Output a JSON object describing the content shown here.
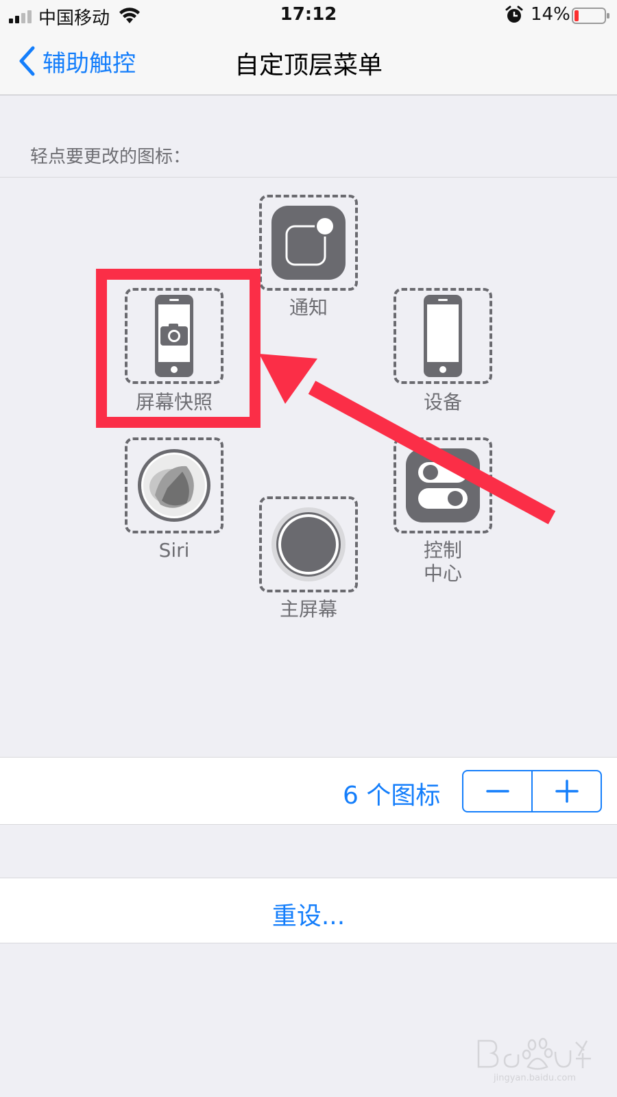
{
  "status_bar": {
    "carrier": "中国移动",
    "time": "17:12",
    "battery_percent": "14%",
    "icons": [
      "signal-icon",
      "wifi-icon",
      "alarm-icon",
      "battery-icon"
    ]
  },
  "nav": {
    "back_label": "辅助触控",
    "title": "自定顶层菜单"
  },
  "section_hint": "轻点要更改的图标：",
  "menu_icons": [
    {
      "label": "通知",
      "icon": "notification-icon"
    },
    {
      "label": "屏幕快照",
      "icon": "screenshot-icon"
    },
    {
      "label": "设备",
      "icon": "device-icon"
    },
    {
      "label": "Siri",
      "icon": "siri-icon"
    },
    {
      "label": "主屏幕",
      "icon": "home-icon"
    },
    {
      "label_line1": "控制",
      "label_line2": "中心",
      "icon": "control-center-icon"
    }
  ],
  "icon_count": {
    "label": "6 个图标",
    "decrement": "−",
    "increment": "+"
  },
  "reset_label": "重设...",
  "watermark_text": "Baidu经验 jingyan.baidu.com",
  "colors": {
    "accent": "#147efb",
    "highlight": "#fb2e47",
    "icon_gray": "#6a6a6f",
    "background": "#efeff4"
  }
}
